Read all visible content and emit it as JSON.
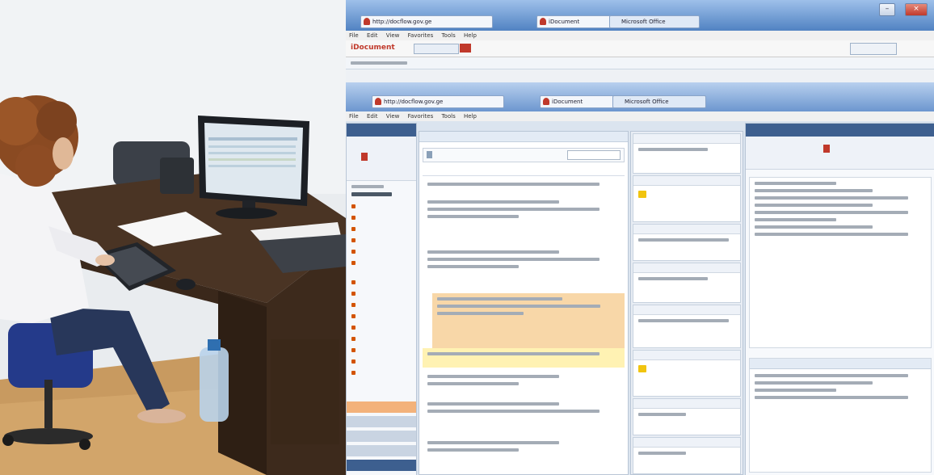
{
  "browser_back": {
    "address": "http://docflow.gov.ge",
    "tab_label": "iDocument",
    "tab2_label": "Microsoft Office",
    "menu": [
      "File",
      "Edit",
      "View",
      "Favorites",
      "Tools",
      "Help"
    ],
    "app_name": "iDocument"
  },
  "browser_front": {
    "address": "http://docflow.gov.ge",
    "tab_label": "iDocument",
    "tab2_label": "Microsoft Office",
    "menu": [
      "File",
      "Edit",
      "View",
      "Favorites",
      "Tools",
      "Help"
    ]
  },
  "colors": {
    "titlebar": "#3f6fb0",
    "highlight_row": "#f8d7a8",
    "selected_row": "#fff2b3",
    "accent_orange": "#d35400",
    "icon_red": "#c0392b"
  },
  "icons": [
    "document-icon",
    "folder-icon",
    "arrow-icon",
    "minimize-icon",
    "maximize-icon",
    "close-icon"
  ]
}
